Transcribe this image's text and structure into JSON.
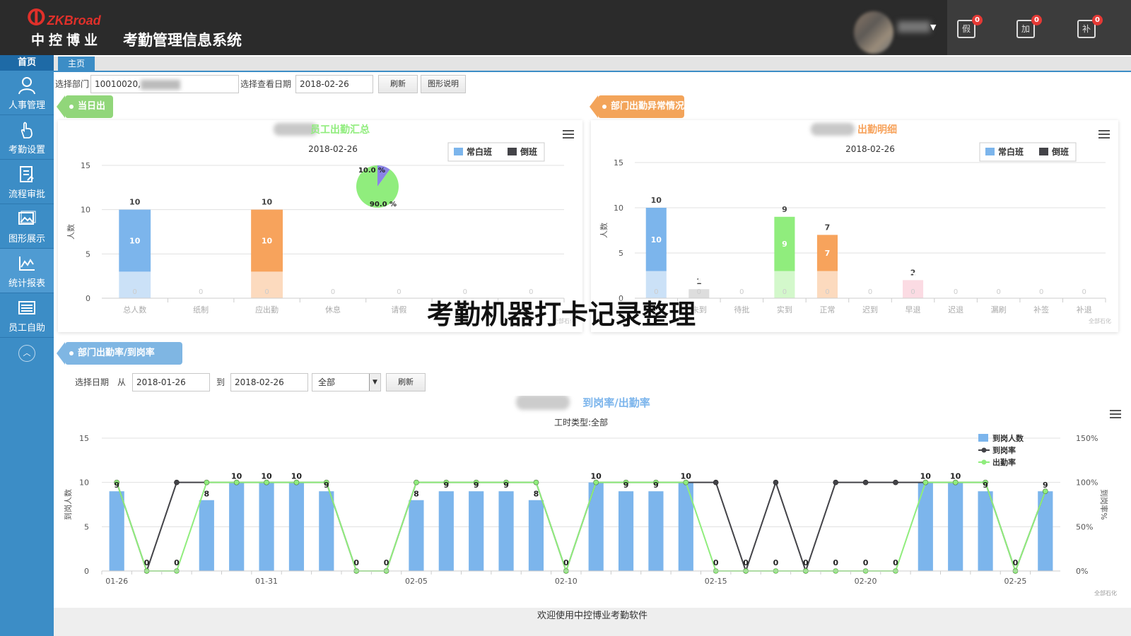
{
  "header": {
    "brand": "ZKBroad",
    "company": "中控博业",
    "system_title": "考勤管理信息系统",
    "user_name": "",
    "quick_actions": [
      {
        "label": "假",
        "badge": "0",
        "icon": "leave-request-icon"
      },
      {
        "label": "加",
        "badge": "0",
        "icon": "overtime-request-icon"
      },
      {
        "label": "补",
        "badge": "0",
        "icon": "punch-correction-icon"
      }
    ]
  },
  "sidebar": {
    "home": "首页",
    "items": [
      {
        "label": "人事管理",
        "icon": "person-icon"
      },
      {
        "label": "考勤设置",
        "icon": "hand-pointer-icon"
      },
      {
        "label": "流程审批",
        "icon": "document-icon"
      },
      {
        "label": "图形展示",
        "icon": "image-icon"
      },
      {
        "label": "统计报表",
        "icon": "line-chart-icon"
      },
      {
        "label": "员工自助",
        "icon": "list-icon"
      }
    ]
  },
  "tabs": [
    "主页"
  ],
  "filters": {
    "dept_label": "选择部门",
    "dept_value": "10010020,",
    "date_label": "选择查看日期",
    "date_value": "2018-02-26",
    "refresh": "刷新",
    "legend_btn": "图形说明"
  },
  "sections": {
    "today": "当日出勤",
    "dept_abnormal": "部门出勤异常情况",
    "rate": "部门出勤率/到岗率"
  },
  "range_filter": {
    "label": "选择日期",
    "from": "从",
    "start": "2018-01-26",
    "to": "到",
    "end": "2018-02-26",
    "scope": "全部",
    "refresh": "刷新"
  },
  "chart_data": [
    {
      "type": "bar",
      "title": "员工出勤汇总",
      "subtitle": "2018-02-26",
      "ylabel": "人数",
      "ylim": [
        0,
        15
      ],
      "yticks": [
        0,
        5,
        10,
        15
      ],
      "categories": [
        "总人数",
        "纸制",
        "应出勤",
        "休息",
        "请假",
        "",
        ""
      ],
      "series": [
        {
          "name": "常白班",
          "values": [
            10,
            0,
            10,
            0,
            0,
            0,
            0
          ]
        },
        {
          "name": "倒班",
          "values": [
            0,
            0,
            0,
            0,
            0,
            0,
            0
          ]
        }
      ],
      "top_labels": [
        "10",
        "",
        "10",
        "",
        "",
        "",
        ""
      ],
      "inset_pie": {
        "slices": [
          {
            "label": "10.0 %",
            "value": 10,
            "color": "#8a84e6"
          },
          {
            "label": "90.0 %",
            "value": 90,
            "color": "#90ed7d"
          }
        ]
      },
      "colors": {
        "常白班": "#7cb5ec",
        "倒班": "#434348",
        "应出勤": "#f7a35c"
      },
      "credit": "全部石化"
    },
    {
      "type": "bar",
      "title": "出勤明细",
      "subtitle": "2018-02-26",
      "ylabel": "人数",
      "ylim": [
        0,
        15
      ],
      "yticks": [
        0,
        5,
        10,
        15
      ],
      "categories": [
        "",
        "未到",
        "待批",
        "实到",
        "正常",
        "迟到",
        "早退",
        "迟退",
        "漏刷",
        "补签",
        "补退"
      ],
      "series": [
        {
          "name": "常白班",
          "values": [
            10,
            1,
            0,
            9,
            7,
            0,
            2,
            0,
            0,
            0,
            0
          ]
        },
        {
          "name": "倒班",
          "values": [
            0,
            0,
            0,
            0,
            0,
            0,
            0,
            0,
            0,
            0,
            0
          ]
        }
      ],
      "colors": {
        "常白班": "#7cb5ec",
        "倒班": "#434348",
        "未到": "#aaaaaa",
        "实到": "#90ed7d",
        "正常": "#f7a35c",
        "早退": "#f4a6b9"
      },
      "credit": "全部石化"
    },
    {
      "type": "bar",
      "title": "到岗率/出勤率",
      "subtitle": "工时类型:全部",
      "ylabel": "到岗人数",
      "y2label": "到岗率%",
      "ylim": [
        0,
        15
      ],
      "yticks": [
        0,
        5,
        10,
        15
      ],
      "y2ticks": [
        "0%",
        "50%",
        "100%",
        "150%"
      ],
      "x": [
        "01-26",
        "01-27",
        "01-28",
        "01-29",
        "01-30",
        "01-31",
        "02-01",
        "02-02",
        "02-03",
        "02-04",
        "02-05",
        "02-06",
        "02-07",
        "02-08",
        "02-09",
        "02-10",
        "02-11",
        "02-12",
        "02-13",
        "02-14",
        "02-15",
        "02-16",
        "02-17",
        "02-18",
        "02-19",
        "02-20",
        "02-21",
        "02-22",
        "02-23",
        "02-24",
        "02-25",
        "02-26"
      ],
      "xticks": [
        "01-26",
        "01-31",
        "02-05",
        "02-10",
        "02-15",
        "02-20",
        "02-25"
      ],
      "series": [
        {
          "name": "到岗人数",
          "values": [
            9,
            0,
            0,
            8,
            10,
            10,
            10,
            9,
            0,
            0,
            8,
            9,
            9,
            9,
            8,
            0,
            10,
            9,
            9,
            10,
            0,
            0,
            0,
            0,
            0,
            0,
            0,
            10,
            10,
            9,
            0,
            9
          ]
        },
        {
          "name": "到岗率",
          "values": [
            100,
            0,
            100,
            100,
            100,
            100,
            100,
            100,
            0,
            0,
            100,
            100,
            100,
            100,
            100,
            0,
            100,
            100,
            100,
            100,
            100,
            0,
            100,
            0,
            100,
            100,
            100,
            100,
            100,
            100,
            0,
            90
          ]
        },
        {
          "name": "出勤率",
          "values": [
            100,
            0,
            0,
            100,
            100,
            100,
            100,
            100,
            0,
            0,
            100,
            100,
            100,
            100,
            100,
            0,
            100,
            100,
            100,
            100,
            0,
            0,
            0,
            0,
            0,
            0,
            0,
            100,
            100,
            100,
            0,
            90
          ]
        }
      ],
      "colors": {
        "到岗人数": "#7cb5ec",
        "到岗率": "#434348",
        "出勤率": "#90ed7d"
      },
      "credit": "全部石化"
    }
  ],
  "footer": "欢迎使用中控博业考勤软件",
  "overlay_title": "考勤机器打卡记录整理"
}
